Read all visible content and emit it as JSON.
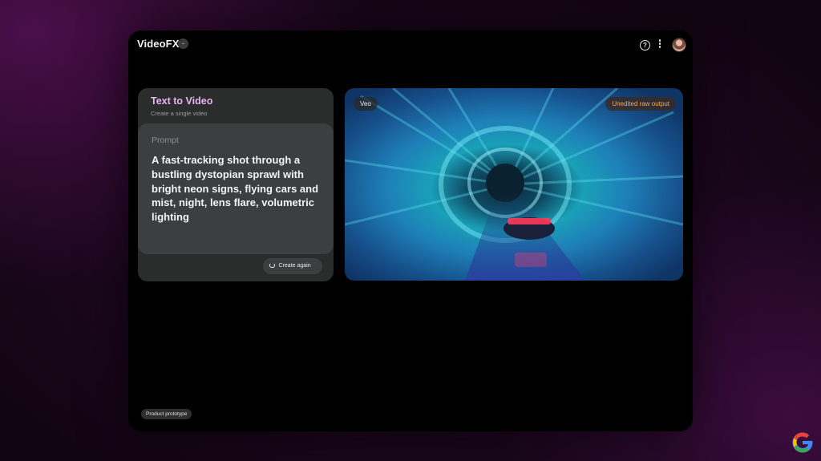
{
  "app": {
    "title": "VideoFX",
    "title_badge": "-"
  },
  "header": {
    "icons": [
      "help-icon",
      "more-vertical-icon",
      "avatar"
    ],
    "help_glyph": "?"
  },
  "prompt_card": {
    "title": "Text to Video",
    "subtitle": "Create a single video",
    "prompt_label": "Prompt",
    "prompt_text": "A fast-tracking shot through a bustling dystopian sprawl with bright neon signs, flying cars and mist, night, lens flare, volumetric lighting",
    "create_again_label": "Create again"
  },
  "video": {
    "model_badge": "Veo",
    "output_badge": "Unedited raw output"
  },
  "footer": {
    "badge": "Product prototype"
  },
  "colors": {
    "accent_title": "#e6b3f0",
    "output_badge_text": "#f0a860",
    "card_bg": "#2b2d2d",
    "prompt_bg": "#3b3f3f"
  }
}
